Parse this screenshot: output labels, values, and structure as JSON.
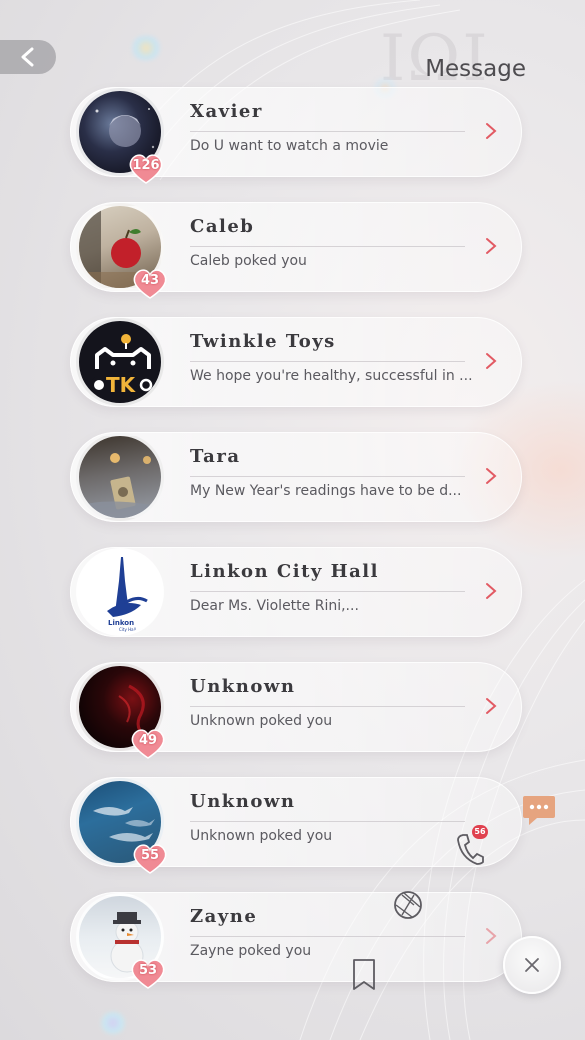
{
  "header": {
    "title": "Message",
    "back_label": "Back"
  },
  "conversations": [
    {
      "name": "Xavier",
      "preview": "Do U want to watch a movie",
      "affection": "126",
      "avatar": "xavier-avatar"
    },
    {
      "name": "Caleb",
      "preview": "Caleb poked you",
      "affection": "43",
      "avatar": "caleb-avatar"
    },
    {
      "name": "Twinkle Toys",
      "preview": "We hope you're healthy, successful in ...",
      "avatar": "twinkle-toys-logo"
    },
    {
      "name": "Tara",
      "preview": "My New Year's readings have to be d...",
      "avatar": "tara-avatar"
    },
    {
      "name": "Linkon City Hall",
      "preview": "Dear Ms. Violette Rini,...",
      "avatar": "linkon-city-hall-logo"
    },
    {
      "name": "Unknown",
      "preview": "Unknown poked you",
      "affection": "49",
      "avatar": "unknown-red-avatar"
    },
    {
      "name": "Unknown",
      "preview": "Unknown poked you",
      "affection": "55",
      "avatar": "unknown-sharks-avatar"
    },
    {
      "name": "Zayne",
      "preview": "Zayne poked you",
      "affection": "53",
      "avatar": "zayne-avatar"
    }
  ],
  "dock": {
    "call_badge": "56",
    "icons": [
      "message-icon",
      "phone-icon",
      "aperture-icon",
      "bookmark-icon",
      "close-icon"
    ]
  },
  "colors": {
    "accent": "#e25a63",
    "message_icon": "#e6a47f",
    "badge": "#e0414f"
  }
}
